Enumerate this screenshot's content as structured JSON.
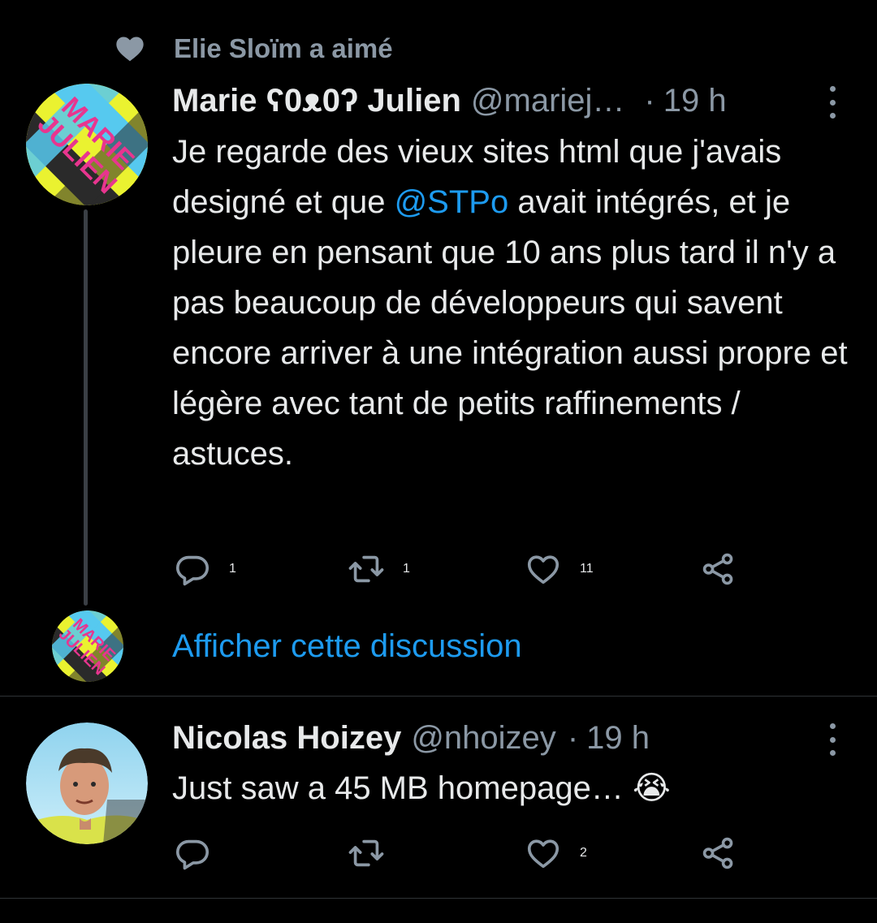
{
  "social_context": {
    "text": "Elie Sloïm a aimé",
    "icon": "heart-icon"
  },
  "tweet1": {
    "display_name": "Marie ʕ0ᴥ0ʔ Julien",
    "handle": "@mariej…",
    "separator": "·",
    "time": "19 h",
    "avatar_text": "MARIE JULIEN",
    "text_before_mention": "Je regarde des vieux sites html que j'avais designé et que ",
    "mention": "@STPo",
    "text_after_mention": " avait intégrés, et je pleure en pensant que 10 ans plus tard il n'y a pas beaucoup de développeurs qui savent encore arriver à une intégration aussi propre et légère avec tant de petits raffinements / astuces.",
    "replies": "1",
    "retweets": "1",
    "likes": "11"
  },
  "show_thread": {
    "label": "Afficher cette discussion"
  },
  "tweet2": {
    "display_name": "Nicolas Hoizey",
    "handle": "@nhoizey",
    "separator": "·",
    "time": "19 h",
    "text": "Just saw a 45 MB homepage… ",
    "emoji": "😭",
    "replies": "",
    "retweets": "",
    "likes": "2"
  },
  "colors": {
    "background": "#000000",
    "text": "#e7e9ea",
    "secondary": "#8b98a5",
    "accent": "#1d9bf0",
    "divider": "#2f3336"
  }
}
